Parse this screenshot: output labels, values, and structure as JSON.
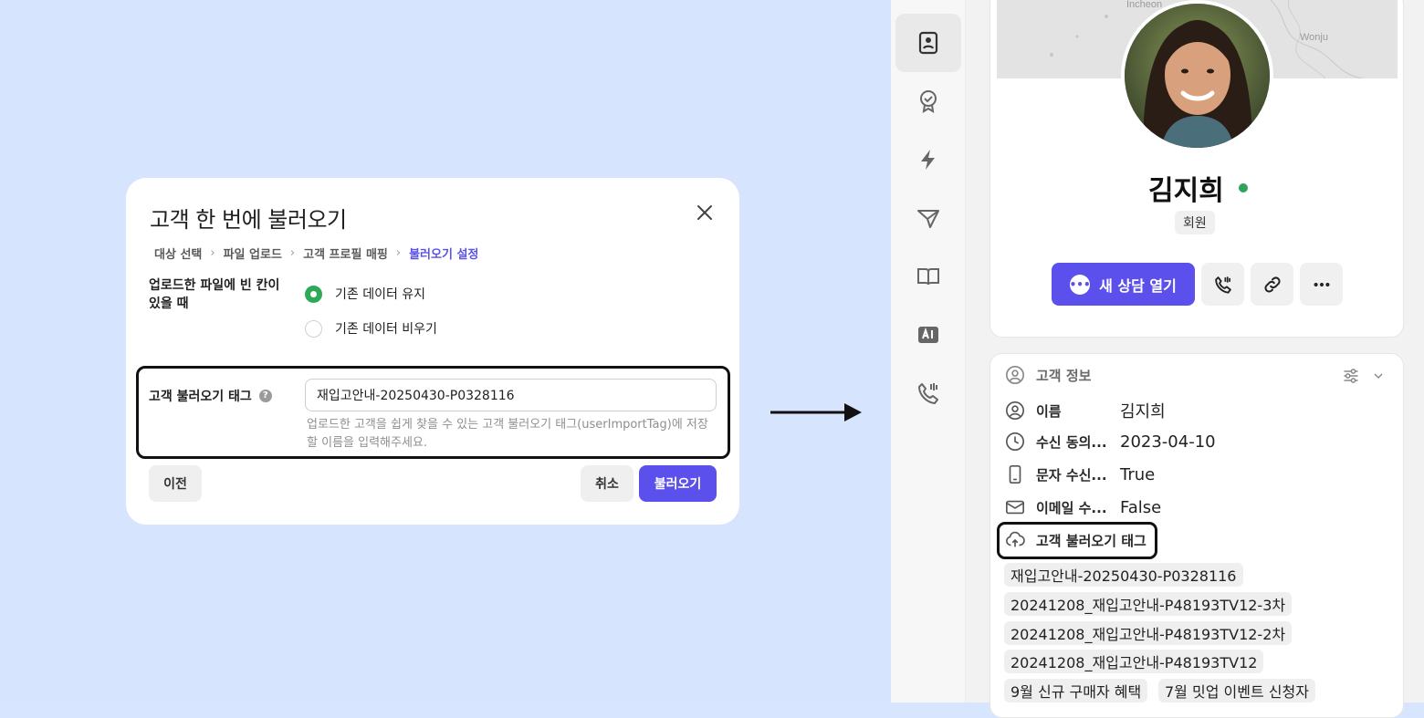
{
  "dialog": {
    "title": "고객 한 번에 불러오기",
    "breadcrumbs": [
      "대상 선택",
      "파일 업로드",
      "고객 프로필 매핑",
      "불러오기 설정"
    ],
    "breadcrumb_sep": "›",
    "empty_cell_label": "업로드한 파일에 빈 칸이 있을 때",
    "radio_options": [
      {
        "label": "기존 데이터 유지",
        "selected": true
      },
      {
        "label": "기존 데이터 비우기",
        "selected": false
      }
    ],
    "import_tag_label": "고객 불러오기 태그",
    "help_glyph": "?",
    "import_tag_value": "재입고안내-20250430-P0328116",
    "import_tag_hint": "업로드한 고객을 쉽게 찾을 수 있는 고객 불러오기 태그(userImportTag)에 저장할 이름을 입력해주세요.",
    "prev_button": "이전",
    "cancel_button": "취소",
    "import_button": "불러오기"
  },
  "profile": {
    "name": "김지희",
    "badge": "회원",
    "chat_button": "새 상담 열기",
    "map_labels": [
      "Incheon",
      "Wonju"
    ],
    "online_color": "#2ca55a"
  },
  "info": {
    "header": "고객 정보",
    "rows": [
      {
        "icon": "user-circle-icon",
        "key": "이름",
        "value": "김지희"
      },
      {
        "icon": "clock-icon",
        "key": "수신 동의...",
        "value": "2023-04-10"
      },
      {
        "icon": "phone-icon",
        "key": "문자 수신...",
        "value": "True"
      },
      {
        "icon": "mail-icon",
        "key": "이메일 수...",
        "value": "False"
      }
    ],
    "tag_header": "고객 불러오기 태그",
    "tags": [
      "재입고안내-20250430-P0328116",
      "20241208_재입고안내-P48193TV12-3차",
      "20241208_재입고안내-P48193TV12-2차",
      "20241208_재입고안내-P48193TV12",
      "9월 신규 구매자 혜택",
      "7월 밋업 이벤트 신청자"
    ]
  },
  "colors": {
    "accent": "#5b50ec",
    "selected_radio": "#2daa55",
    "left_background": "#d6e4fe"
  }
}
